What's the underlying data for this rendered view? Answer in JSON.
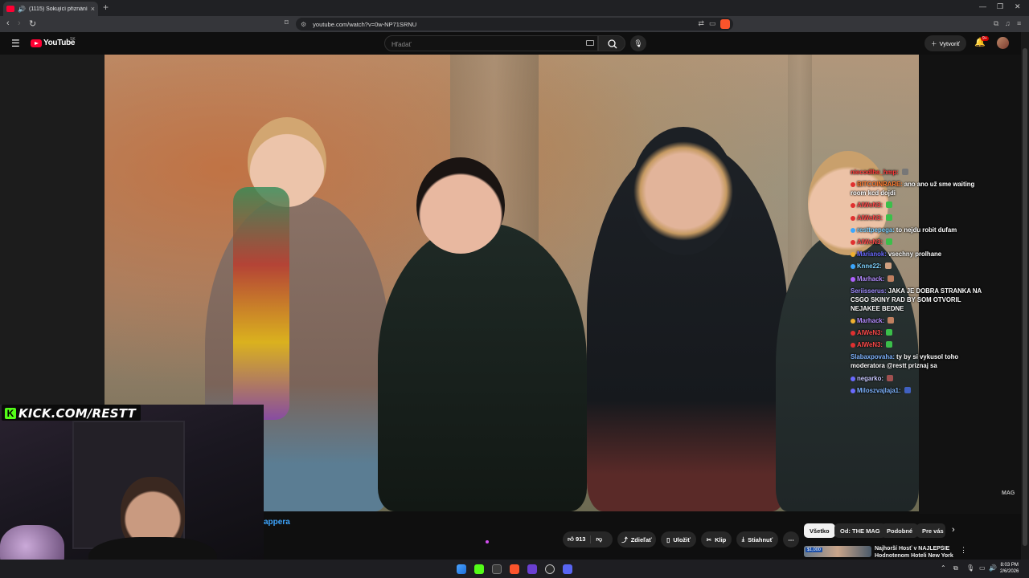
{
  "browser": {
    "tab_title": "(1115) Šokující přiznání, které",
    "new_tab": "+",
    "url": "youtube.com/watch?v=0w-NP71SRNU",
    "window_controls": [
      "—",
      "❐",
      "✕"
    ]
  },
  "youtube": {
    "logo_text": "YouTube",
    "country": "SK",
    "search_placeholder": "Hľadať",
    "create_label": "Vytvoriť",
    "notif_count": "9+"
  },
  "stream_overlay": {
    "kick_text": "KICK.COM/RESTT",
    "watermark": "MAG"
  },
  "chat": [
    {
      "user": "niecodlhe_hmp:",
      "msg": "",
      "color": "#ff3b3b",
      "dot": "",
      "badge": "#777"
    },
    {
      "user": "BITCOINRARE:",
      "msg": "ano ano už sme waiting room kcd dojdi",
      "color": "#ff7a2f",
      "dot": "#e03030",
      "badge": ""
    },
    {
      "user": "AIWeN3:",
      "msg": "",
      "color": "#ff4b4b",
      "dot": "#e03030",
      "badge": "#3bbf4a"
    },
    {
      "user": "AIWeN3:",
      "msg": "",
      "color": "#ff4b4b",
      "dot": "#e03030",
      "badge": "#3bbf4a"
    },
    {
      "user": "resttpepega:",
      "msg": "to nejdu robit dufam",
      "color": "#7fd3ff",
      "dot": "#3aa7ff",
      "badge": ""
    },
    {
      "user": "AIWeN3:",
      "msg": "",
      "color": "#ff4b4b",
      "dot": "#e03030",
      "badge": "#3bbf4a"
    },
    {
      "user": "Marianok:",
      "msg": "vsechny prolhane",
      "color": "#6a6aff",
      "dot": "#f0b030",
      "badge": ""
    },
    {
      "user": "Knne22:",
      "msg": "",
      "color": "#7fd3ff",
      "dot": "#3aa7ff",
      "badge": "#d0a080"
    },
    {
      "user": "Marhack:",
      "msg": "",
      "color": "#b48cff",
      "dot": "#b060ff",
      "badge": "#c08060"
    },
    {
      "user": "Seriisserus:",
      "msg": "JAKA JE DOBRA STRANKA NA CSGO SKINY RAD BY SOM OTVORIL NEJAKEE BEDNE",
      "color": "#a08cff",
      "dot": "",
      "badge": ""
    },
    {
      "user": "Marhack:",
      "msg": "",
      "color": "#b48cff",
      "dot": "#f0b030",
      "badge": "#c08060"
    },
    {
      "user": "AIWeN3:",
      "msg": "",
      "color": "#ff4b4b",
      "dot": "#e03030",
      "badge": "#3bbf4a"
    },
    {
      "user": "AIWeN3:",
      "msg": "",
      "color": "#ff4b4b",
      "dot": "#e03030",
      "badge": "#3bbf4a"
    },
    {
      "user": "Slabaxpovaha:",
      "msg": "ty by si vykusol toho moderatora @restt priznaj sa",
      "color": "#7fb4ff",
      "dot": "",
      "badge": ""
    },
    {
      "user": "negarko:",
      "msg": "",
      "color": "#c8c8ff",
      "dot": "#6a6aff",
      "badge": "#a05050"
    },
    {
      "user": "Miloszvajlaja1:",
      "msg": "",
      "color": "#7fb4ff",
      "dot": "#6a6aff",
      "badge": "#4060c0"
    }
  ],
  "below_video": {
    "channel_partial": "appera",
    "likes": "913",
    "share": "Zdieľať",
    "save": "Uložiť",
    "clip": "Klip",
    "download": "Stiahnuť",
    "more": "⋯"
  },
  "chips": [
    "Všetko",
    "Od: THE MAG",
    "Podobné",
    "Pre vás"
  ],
  "recommendation": {
    "price_badge": "$1,000",
    "title": "Najhorší Hosť v NAJLEPŠIE Hodnotenom Hoteli New York"
  },
  "taskbar": {
    "time": "8:03 PM",
    "date": "2/6/2026"
  }
}
